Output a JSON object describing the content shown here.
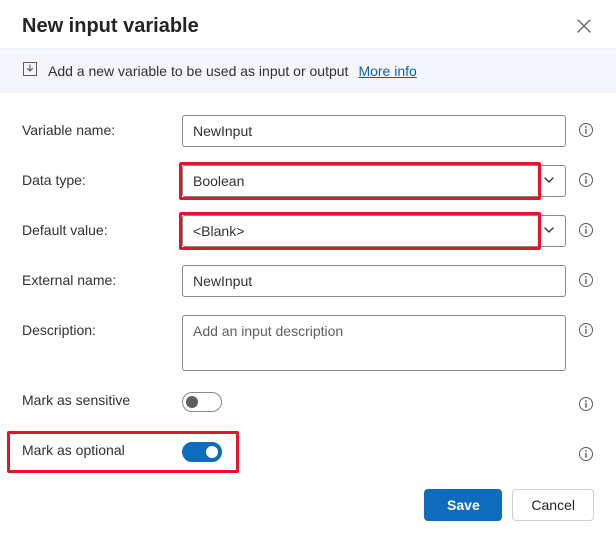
{
  "dialog": {
    "title": "New input variable",
    "info_text": "Add a new variable to be used as input or output",
    "more_info_label": "More info"
  },
  "labels": {
    "variable_name": "Variable name:",
    "data_type": "Data type:",
    "default_value": "Default value:",
    "external_name": "External name:",
    "description": "Description:",
    "mark_sensitive": "Mark as sensitive",
    "mark_optional": "Mark as optional"
  },
  "values": {
    "variable_name": "NewInput",
    "data_type": "Boolean",
    "default_value": "<Blank>",
    "external_name": "NewInput",
    "description": "",
    "description_placeholder": "Add an input description",
    "mark_sensitive": false,
    "mark_optional": true
  },
  "buttons": {
    "save": "Save",
    "cancel": "Cancel"
  }
}
